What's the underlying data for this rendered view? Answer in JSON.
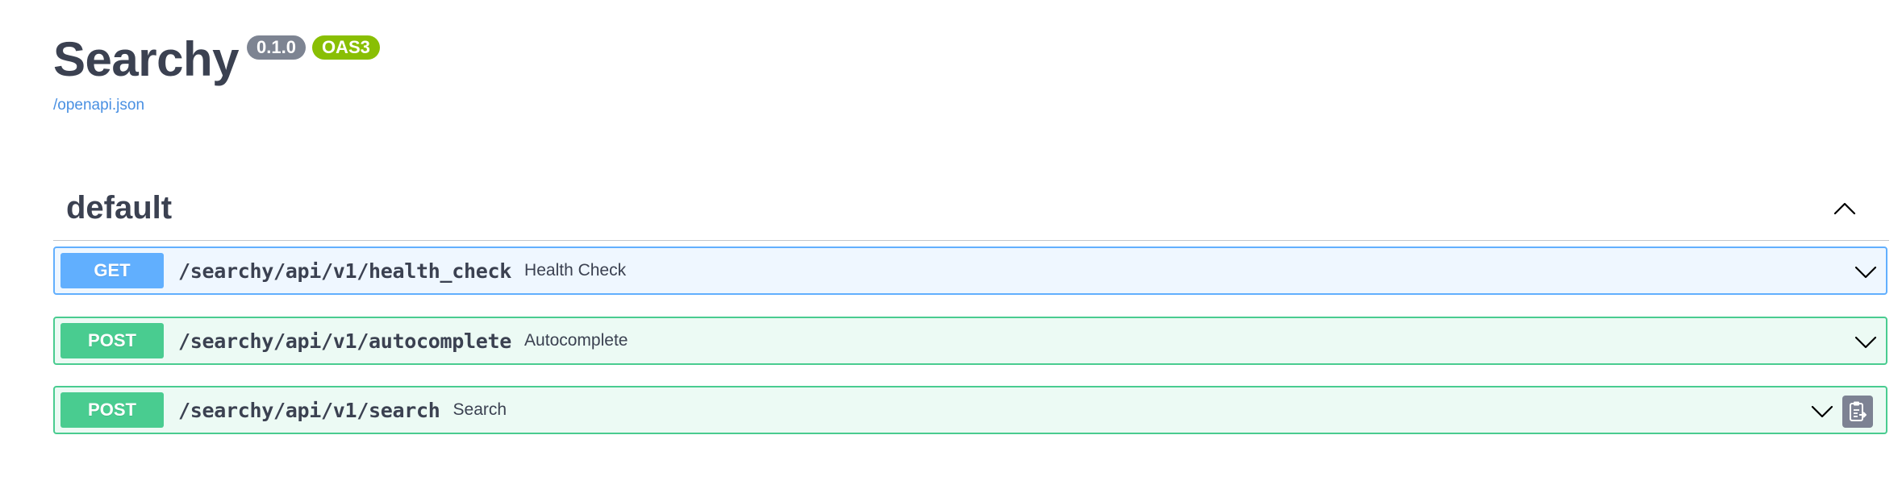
{
  "info": {
    "title": "Searchy",
    "version": "0.1.0",
    "oas_badge": "OAS3",
    "spec_link": "/openapi.json"
  },
  "tag": {
    "name": "default",
    "expanded": true
  },
  "operations": [
    {
      "method": "GET",
      "path": "/searchy/api/v1/health_check",
      "summary": "Health Check"
    },
    {
      "method": "POST",
      "path": "/searchy/api/v1/autocomplete",
      "summary": "Autocomplete"
    },
    {
      "method": "POST",
      "path": "/searchy/api/v1/search",
      "summary": "Search"
    }
  ],
  "colors": {
    "get": "#61affe",
    "post": "#49cc90",
    "version_badge": "#7d8492",
    "oas_badge": "#89bf04",
    "link": "#4990e2",
    "text": "#3b4151"
  },
  "icons": {
    "tag_toggle": "chevron-up-icon",
    "op_toggle": "chevron-down-icon",
    "copy": "clipboard-copy-icon"
  }
}
